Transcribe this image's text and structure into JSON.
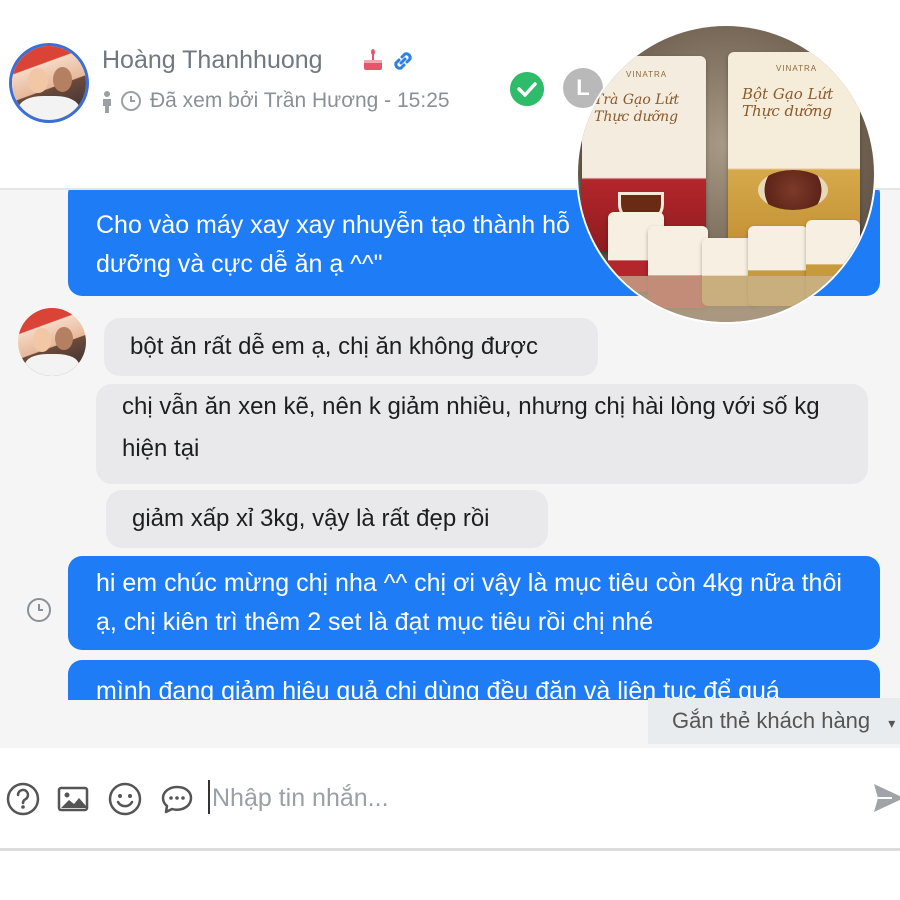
{
  "header": {
    "name": "Hoàng Thanhhuong",
    "seen_text": "Đã xem bởi Trần Hương - 15:25",
    "label_letter": "L"
  },
  "chat": {
    "partial_top_line": "Cho vào máy xay xay nhuyễn tạo thành hỗ",
    "partial_top_line2": "dưỡng và cực dễ ăn ạ ^^\"",
    "incoming": [
      "bột ăn rất dễ em ạ, chị ăn không được",
      "chị vẫn ăn xen kẽ, nên k giảm nhiều, nhưng chị hài lòng với số kg hiện tại",
      "giảm xấp xỉ 3kg, vậy là rất đẹp rồi"
    ],
    "outgoing": "hi em chúc mừng chị nha ^^ chị ơi vậy là mục tiêu còn 4kg nữa thôi ạ, chị kiên trì thêm 2 set là đạt mục tiêu rồi chị nhé",
    "outgoing_partial": "mình đang giảm hiệu quả chị dùng đều đặn và liên tục để quá"
  },
  "tag_button": "Gắn thẻ khách hàng",
  "composer": {
    "placeholder": "Nhập tin nhắn..."
  },
  "product": {
    "brand": "VINATRA",
    "bag_tea_title": "Trà Gạo Lứt Thực dưỡng",
    "bag_powder_title": "Bột Gạo Lứt Thực dưỡng"
  },
  "colors": {
    "outgoing_bubble": "#1e7df6",
    "incoming_bubble": "#e9e9eb",
    "check_green": "#2fbc6a"
  }
}
